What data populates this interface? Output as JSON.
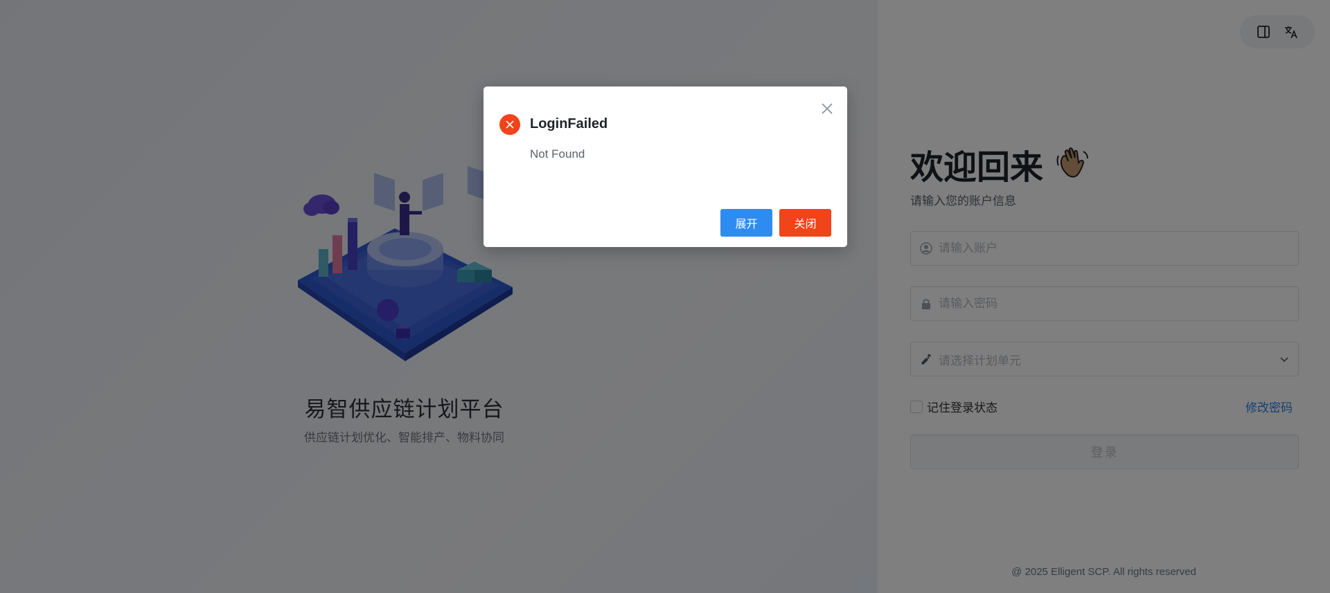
{
  "hero": {
    "title": "易智供应链计划平台",
    "subtitle": "供应链计划优化、智能排产、物料协同",
    "illustration": "isometric-data-platform-illustration"
  },
  "toolbar": {
    "layout_icon": "sidebar-layout-icon",
    "language_icon": "translate-icon"
  },
  "login": {
    "title": "欢迎回来",
    "title_emoji_icon": "waving-hand-icon",
    "subtitle": "请输入您的账户信息",
    "account_placeholder": "请输入账户",
    "account_icon": "user-icon",
    "password_placeholder": "请输入密码",
    "password_icon": "lock-icon",
    "plan_unit_placeholder": "请选择计划单元",
    "plan_unit_icon": "wrench-icon",
    "remember_label": "记住登录状态",
    "remember_checked": false,
    "change_password": "修改密码",
    "submit_label": "登录"
  },
  "footer": {
    "copyright": "@ 2025 Elligent SCP. All rights reserved"
  },
  "modal": {
    "title": "LoginFailed",
    "message": "Not Found",
    "expand_label": "展开",
    "close_label": "关闭",
    "icon": "error-circle-icon",
    "colors": {
      "error": "#f0441a",
      "primary": "#2e8cf0"
    }
  }
}
